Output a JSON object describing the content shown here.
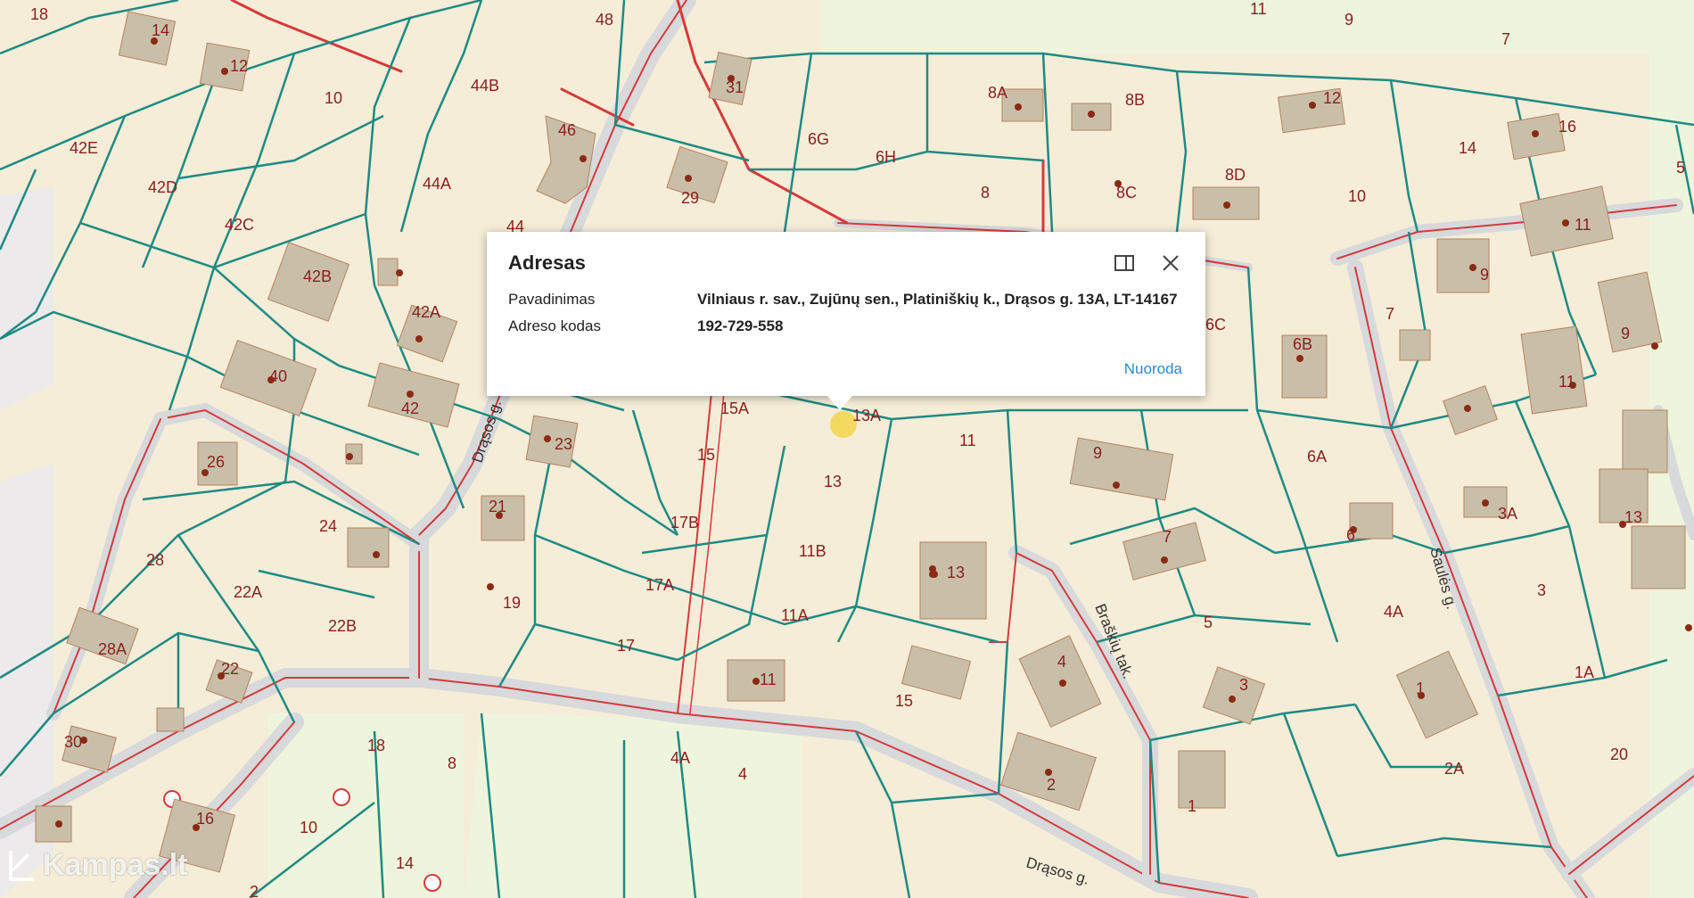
{
  "popup": {
    "title": "Adresas",
    "rows": [
      {
        "label": "Pavadinimas",
        "value": "Vilniaus r. sav., Zujūnų sen., Platiniškių k., Drąsos g. 13A, LT-14167"
      },
      {
        "label": "Adreso kodas",
        "value": "192-729-558"
      }
    ],
    "link": "Nuoroda"
  },
  "watermark": "Kampas.lt",
  "streets": [
    "Drąsos g.",
    "Braškių tak.",
    "Saulės g.",
    "Drąsos g."
  ],
  "plots": [
    "18",
    "14",
    "12",
    "10",
    "48",
    "31",
    "11",
    "9",
    "7",
    "42E",
    "44B",
    "46",
    "6G",
    "6H",
    "8A",
    "8B",
    "12",
    "16",
    "14",
    "5",
    "42D",
    "44A",
    "29",
    "8",
    "8D",
    "8C",
    "10",
    "42C",
    "44",
    "11",
    "42B",
    "42A",
    "6C",
    "6B",
    "7",
    "9",
    "9",
    "40",
    "42",
    "15A",
    "13A",
    "11",
    "9",
    "6A",
    "11",
    "26",
    "23",
    "15",
    "13",
    "3A",
    "21",
    "17B",
    "24",
    "28",
    "11B",
    "13",
    "7",
    "6",
    "13",
    "22A",
    "19",
    "17A",
    "11A",
    "5",
    "4A",
    "3",
    "22B",
    "28A",
    "17",
    "22",
    "11",
    "15",
    "4",
    "3",
    "1",
    "1A",
    "30",
    "18",
    "8",
    "4A",
    "4",
    "2",
    "2A",
    "1",
    "20",
    "16",
    "10",
    "14",
    "2"
  ],
  "colors": {
    "plot_fill": "#f5edd8",
    "plot_stroke": "#1e8a84",
    "road_fill": "#d7d9db",
    "road_edge": "#d63a3a",
    "building": "#c9bfa8",
    "field": "#eef5dc",
    "marker": "#f2d64a",
    "link": "#2a8bd1"
  }
}
